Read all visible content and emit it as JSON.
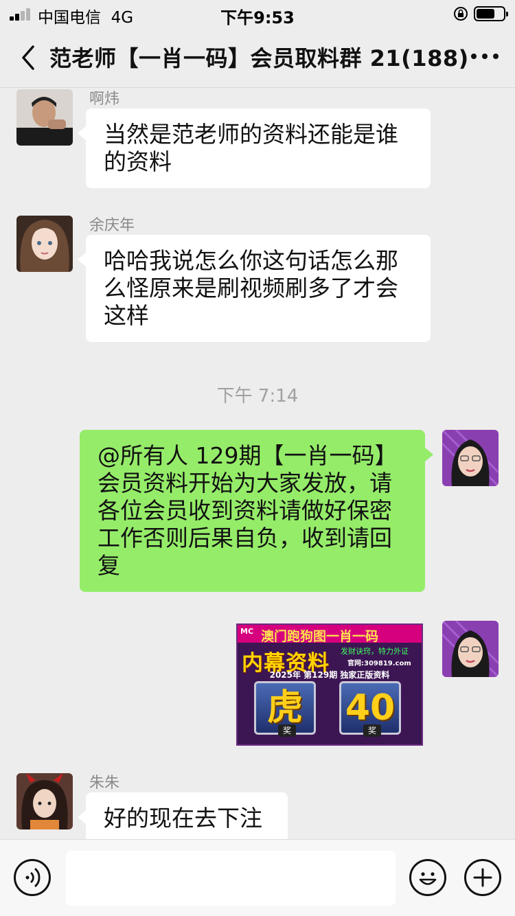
{
  "status_bar": {
    "carrier": "中国电信",
    "network": "4G",
    "time": "下午9:53"
  },
  "nav": {
    "title": "范老师【一肖一码】会员取料群 21(188)"
  },
  "messages": [
    {
      "sender": "啊炜",
      "lines": [
        "当然是范老师的资料还能是谁",
        "的资料"
      ]
    },
    {
      "sender": "余庆年",
      "lines": [
        "哈哈我说怎么你这句话怎么那",
        "么怪原来是刷视频刷多了才会",
        "这样"
      ]
    },
    {
      "timestamp": "下午 7:14"
    },
    {
      "outgoing": true,
      "lines": [
        "@所有人 129期【一肖一码】",
        "会员资料开始为大家发放，请",
        "各位会员收到资料请做好保密",
        "工作否则后果自负，收到请回",
        "复"
      ]
    },
    {
      "outgoing": true,
      "image": {
        "logo": "MC",
        "header": "澳门跑狗图一肖一码",
        "inner": "内幕资料",
        "slogan": "发财诀窍，特力外证",
        "website": "官网:309819.com",
        "issue": "2025年 第129期 独家正版资料",
        "badge_left": "虎",
        "badge_right": "40",
        "badge_foot": "奖"
      }
    },
    {
      "sender": "朱朱",
      "lines": [
        "好的现在去下注"
      ]
    }
  ],
  "input": {
    "placeholder": ""
  }
}
